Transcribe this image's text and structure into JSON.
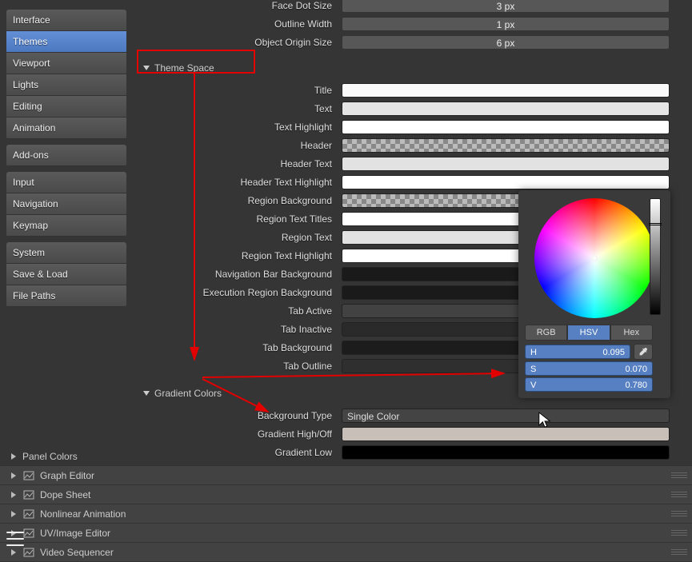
{
  "sidebar": {
    "groups": [
      [
        "Interface",
        "Themes",
        "Viewport",
        "Lights",
        "Editing",
        "Animation"
      ],
      [
        "Add-ons"
      ],
      [
        "Input",
        "Navigation",
        "Keymap"
      ],
      [
        "System",
        "Save & Load",
        "File Paths"
      ]
    ],
    "active": "Themes"
  },
  "top_props": [
    {
      "label": "Face Dot Size",
      "value": "3 px"
    },
    {
      "label": "Outline Width",
      "value": "1 px"
    },
    {
      "label": "Object Origin Size",
      "value": "6 px"
    }
  ],
  "theme_space": {
    "title": "Theme Space",
    "rows": [
      {
        "label": "Title",
        "color": "#f9f9f9"
      },
      {
        "label": "Text",
        "color": "#e5e5e5"
      },
      {
        "label": "Text Highlight",
        "color": "#ffffff"
      },
      {
        "label": "Header",
        "checker": true
      },
      {
        "label": "Header Text",
        "color": "#e2e2e2"
      },
      {
        "label": "Header Text Highlight",
        "color": "#ffffff"
      },
      {
        "label": "Region Background",
        "checker": true
      },
      {
        "label": "Region Text Titles",
        "color": "#ffffff"
      },
      {
        "label": "Region Text",
        "color": "#e2e2e2"
      },
      {
        "label": "Region Text Highlight",
        "color": "#ffffff"
      },
      {
        "label": "Navigation Bar Background",
        "color": "#1a1a1a"
      },
      {
        "label": "Execution Region Background",
        "color": "#1a1a1a"
      },
      {
        "label": "Tab Active",
        "color": "#424242"
      },
      {
        "label": "Tab Inactive",
        "color": "#2a2a2a"
      },
      {
        "label": "Tab Background",
        "color": "#1c1c1c"
      },
      {
        "label": "Tab Outline",
        "color": "#2f2f2f"
      }
    ]
  },
  "gradient": {
    "title": "Gradient Colors",
    "bgtype_label": "Background Type",
    "bgtype_value": "Single Color",
    "high_label": "Gradient High/Off",
    "high_color": "#c8c0b8",
    "low_label": "Gradient Low",
    "low_color": "#000000"
  },
  "picker": {
    "modes": [
      "RGB",
      "HSV",
      "Hex"
    ],
    "mode_active": "HSV",
    "h_label": "H",
    "h_value": "0.095",
    "s_label": "S",
    "s_value": "0.070",
    "v_label": "V",
    "v_value": "0.780"
  },
  "editors": [
    {
      "label": "Panel Colors",
      "icon": ""
    },
    {
      "label": "Graph Editor",
      "icon": "graph"
    },
    {
      "label": "Dope Sheet",
      "icon": "dope"
    },
    {
      "label": "Nonlinear Animation",
      "icon": "nla"
    },
    {
      "label": "UV/Image Editor",
      "icon": "uv"
    },
    {
      "label": "Video Sequencer",
      "icon": "vse"
    }
  ]
}
